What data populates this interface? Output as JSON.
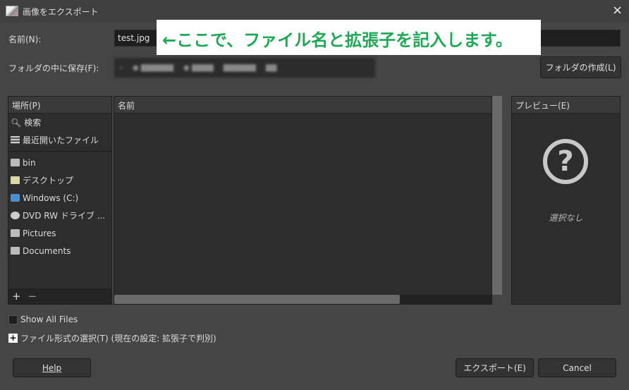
{
  "window": {
    "title": "画像をエクスポート",
    "close_icon": "×"
  },
  "name_field": {
    "label": "名前(N):",
    "value": "test.jpg"
  },
  "annotation": "←ここで、ファイル名と拡張子を記入します。",
  "folder": {
    "label": "フォルダの中に保存(F):",
    "create_folder_button": "フォルダの作成(L)"
  },
  "places": {
    "header": "場所(P)",
    "items": [
      {
        "label": "検索",
        "icon": "search-icon"
      },
      {
        "label": "最近開いたファイル",
        "icon": "recent-icon"
      },
      {
        "label": "bin",
        "icon": "folder-icon"
      },
      {
        "label": "デスクトップ",
        "icon": "folder-icon"
      },
      {
        "label": "Windows (C:)",
        "icon": "drive-icon"
      },
      {
        "label": "DVD RW ドライブ ...",
        "icon": "dvd-icon"
      },
      {
        "label": "Pictures",
        "icon": "folder-icon"
      },
      {
        "label": "Documents",
        "icon": "folder-icon"
      }
    ],
    "add": "+",
    "remove": "−"
  },
  "files": {
    "header": "名前"
  },
  "preview": {
    "header": "プレビュー(E)",
    "empty": "選択なし"
  },
  "show_all_files": "Show All Files",
  "file_type": "ファイル形式の選択(T) (現在の設定: 拡張子で判別)",
  "buttons": {
    "help": "Help",
    "export": "エクスポート(E)",
    "cancel": "Cancel"
  }
}
